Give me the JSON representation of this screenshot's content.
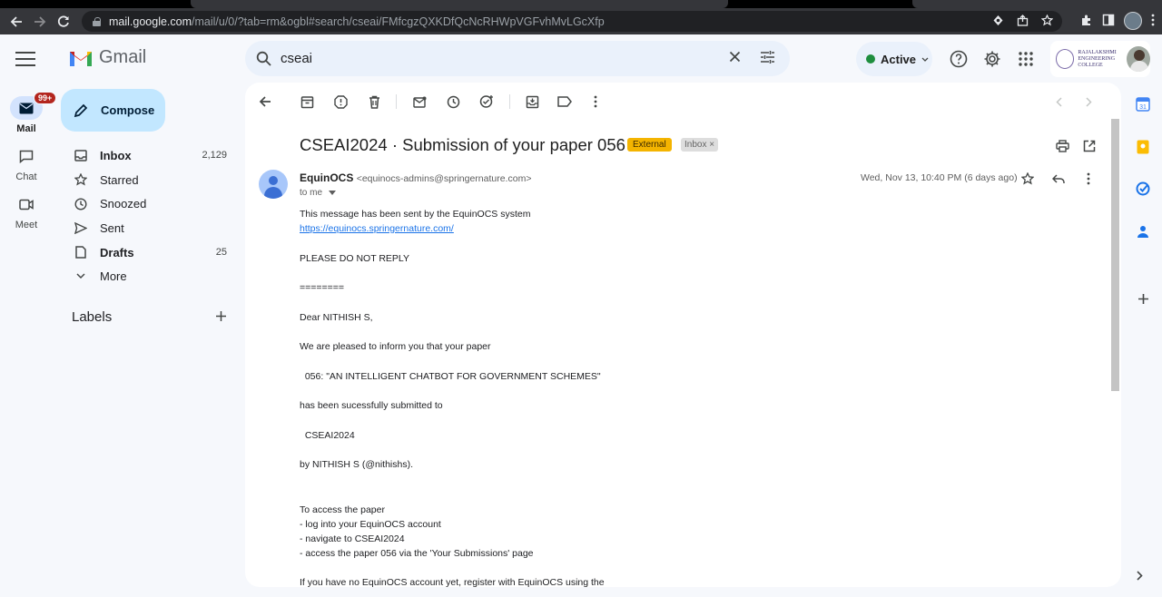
{
  "browser": {
    "url_host": "mail.google.com",
    "url_path": "/mail/u/0/?tab=rm&ogbl#search/cseai/FMfcgzQXKDfQcNcRHWpVGFvhMvLGcXfp"
  },
  "app": {
    "logo_text": "Gmail",
    "compose_label": "Compose"
  },
  "rail": {
    "mail_label": "Mail",
    "mail_badge": "99+",
    "chat_label": "Chat",
    "meet_label": "Meet"
  },
  "folders": [
    {
      "label": "Inbox",
      "count": "2,129",
      "icon": "inbox-icon"
    },
    {
      "label": "Starred",
      "count": "",
      "icon": "star-icon"
    },
    {
      "label": "Snoozed",
      "count": "",
      "icon": "clock-icon"
    },
    {
      "label": "Sent",
      "count": "",
      "icon": "send-icon"
    },
    {
      "label": "Drafts",
      "count": "25",
      "icon": "draft-icon"
    },
    {
      "label": "More",
      "count": "",
      "icon": "chevron-down-icon"
    }
  ],
  "labels": {
    "heading": "Labels"
  },
  "search": {
    "query": "cseai"
  },
  "status": {
    "label": "Active",
    "color": "#1e8e3e"
  },
  "org": {
    "name": "RAJALAKSHMI ENGINEERING COLLEGE"
  },
  "message": {
    "subject": "CSEAI2024 · Submission of your paper 056",
    "tag_external": "External",
    "tag_inbox": "Inbox ×",
    "sender_name": "EquinOCS",
    "sender_email": "<equinocs-admins@springernature.com>",
    "to": "to me",
    "date": "Wed, Nov 13, 10:40 PM (6 days ago)",
    "body": [
      "This message has been sent by the EquinOCS system",
      "https://equinocs.springernature.com/",
      "PLEASE DO NOT REPLY",
      "========",
      "Dear NITHISH S,",
      "We are pleased to inform you that your paper",
      "  056: \"AN INTELLIGENT CHATBOT FOR GOVERNMENT SCHEMES\"",
      "has been sucessfully submitted to",
      "  CSEAI2024",
      "by NITHISH S (@nithishs).",
      "To access the paper",
      "- log into your EquinOCS account",
      "- navigate to CSEAI2024",
      "- access the paper 056 via the 'Your Submissions' page",
      "If you have no EquinOCS account yet, register with EquinOCS using the"
    ]
  },
  "colors": {
    "accent": "#c2e7ff",
    "external_tag": "#f4b400",
    "link": "#1a73e8"
  }
}
